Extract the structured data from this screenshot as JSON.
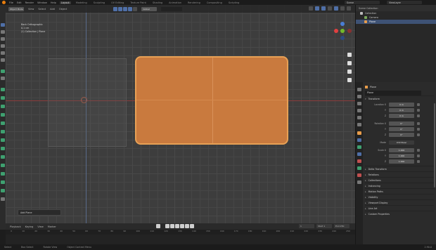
{
  "topbar": {
    "menus": [
      "File",
      "Edit",
      "Render",
      "Window",
      "Help"
    ],
    "workspaces": [
      "Layout",
      "Modeling",
      "Sculpting",
      "UV Editing",
      "Texture Paint",
      "Shading",
      "Animation",
      "Rendering",
      "Compositing",
      "Scripting"
    ],
    "active_workspace": "Layout",
    "scene": "Scene",
    "view_layer": "ViewLayer"
  },
  "viewport": {
    "header": {
      "mode": "Object Mode",
      "menus": [
        "View",
        "Select",
        "Add",
        "Object"
      ],
      "transform": "Global"
    },
    "overlay": {
      "view": "Back Orthographic",
      "units": "0.1 cm",
      "collection": "(1) Collection | Plane"
    },
    "gizmo_colors": {
      "x": "#e04040",
      "y": "#74ba2a",
      "z": "#4a7ed6"
    },
    "selection_color": "#e79c4a",
    "operator_panel": "Add Plane"
  },
  "timeline": {
    "menus": [
      "Playback",
      "Keying",
      "View",
      "Marker"
    ],
    "ruler": [
      "0",
      "10",
      "20",
      "30",
      "40",
      "50",
      "60",
      "70",
      "80",
      "90",
      "100",
      "110",
      "120",
      "130",
      "140",
      "150",
      "160",
      "170",
      "180",
      "190",
      "200",
      "210",
      "220",
      "230",
      "240",
      "250"
    ],
    "current_frame": "1",
    "start": "Start 1",
    "end": "End 250"
  },
  "statusbar": {
    "select": "Select",
    "box_select": "Box Select",
    "rotate": "Rotate View",
    "context": "Object Context Menu",
    "version": "2.90.0"
  },
  "outliner": {
    "title": "Scene Collection",
    "items": [
      {
        "label": "Collection",
        "icon": "collection-icon"
      },
      {
        "label": "Camera",
        "icon": "camera-icon"
      },
      {
        "label": "Plane",
        "icon": "mesh-icon",
        "selected": true
      }
    ]
  },
  "properties": {
    "object_name": "Plane",
    "data_name": "Plane",
    "transform_label": "Transform",
    "location_label": "Location X",
    "location": [
      "0 m",
      "0 m",
      "0 m"
    ],
    "rotation_label": "Rotation X",
    "rotation": [
      "0°",
      "0°",
      "0°"
    ],
    "mode_label": "Mode",
    "mode_value": "XYZ Euler",
    "scale_label": "Scale X",
    "scale": [
      "1.000",
      "1.000",
      "1.000"
    ],
    "axis_labels": [
      "Y",
      "Z"
    ],
    "sections": [
      "Delta Transform",
      "Relations",
      "Collections",
      "Instancing",
      "Motion Paths",
      "Visibility",
      "Viewport Display",
      "Line Art",
      "Custom Properties"
    ]
  }
}
